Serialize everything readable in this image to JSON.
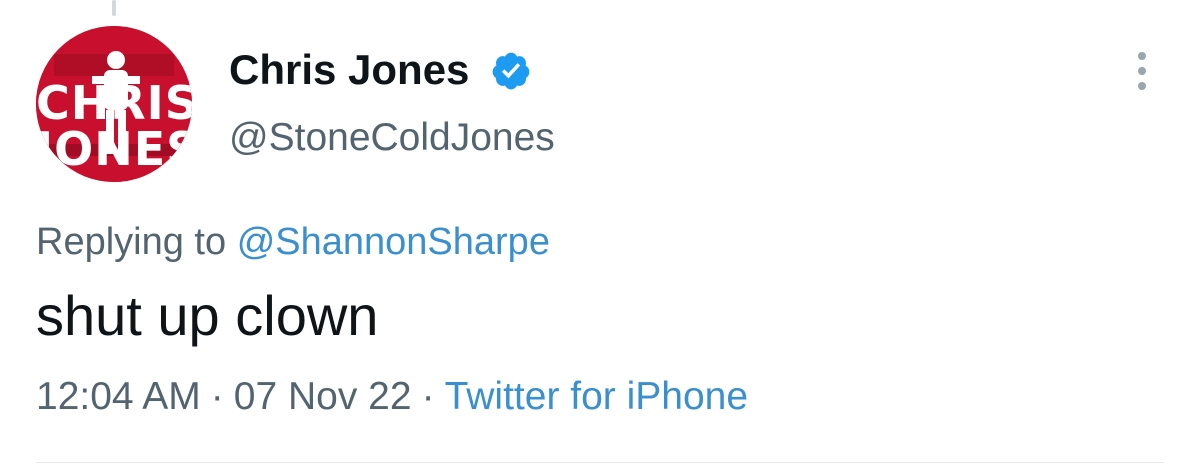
{
  "avatar": {
    "line1": "CHRIS",
    "line2": "JONES",
    "bg_color": "#c8102e",
    "icon": "avatar"
  },
  "author": {
    "display_name": "Chris Jones",
    "handle": "@StoneColdJones",
    "verified": true,
    "verified_color": "#1d9bf0"
  },
  "reply": {
    "prefix": "Replying to",
    "to_handle": "@ShannonSharpe"
  },
  "tweet": {
    "text": "shut up clown"
  },
  "meta": {
    "time": "12:04 AM",
    "separator": "·",
    "date": "07 Nov 22",
    "source": "Twitter for iPhone"
  },
  "colors": {
    "text_primary": "#0f1419",
    "text_secondary": "#536471",
    "link": "#3a8fcf"
  }
}
